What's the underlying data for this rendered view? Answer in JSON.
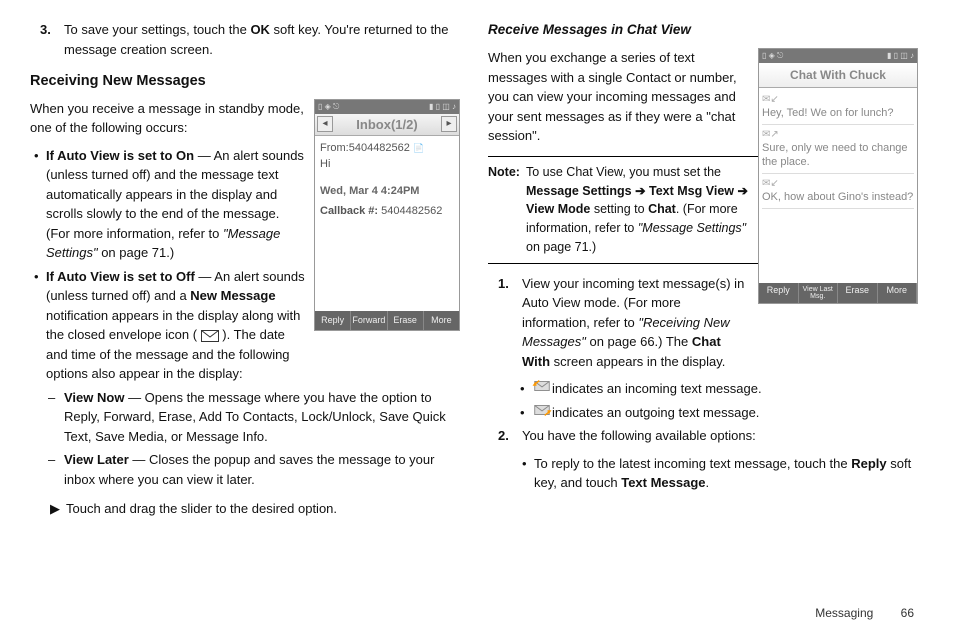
{
  "left": {
    "step3_num": "3.",
    "step3_text_a": "To save your settings, touch the ",
    "step3_ok": "OK",
    "step3_text_b": " soft key. You're returned to the message creation screen.",
    "h2": "Receiving New Messages",
    "intro": "When you receive a message in standby mode, one of the following occurs:",
    "b1_lead": "If Auto View is set to On",
    "b1_rest": " — An alert sounds (unless turned off) and the message text automatically appears in the display and scrolls slowly to the end of the message. (For more information, refer to ",
    "b1_ref": "\"Message Settings\"",
    "b1_pg": "  on page 71.)",
    "b2_lead": "If Auto View is set to Off",
    "b2_rest_a": " — An alert sounds (unless turned off) and a ",
    "b2_newmsg": "New Message",
    "b2_rest_b": " notification appears in the display along with the closed envelope icon ( ",
    "b2_rest_c": " ). The date and time of the message and the following options also appear in the display:",
    "vn_lead": "View Now",
    "vn_rest": " — Opens the message where you have the option to Reply, Forward, Erase, Add To Contacts, Lock/Unlock, Save Quick Text, Save Media, or Message Info.",
    "vl_lead": "View Later",
    "vl_rest": " — Closes the popup and saves the message to your inbox where you can view it later.",
    "slider": "Touch and drag the slider to the desired option."
  },
  "phone1": {
    "title": "Inbox(1/2)",
    "from": "From:5404482562",
    "hi": "Hi",
    "date": "Wed, Mar 4 4:24PM",
    "callback_lbl": "Callback #:",
    "callback_num": " 5404482562",
    "sk": [
      "Reply",
      "Forward",
      "Erase",
      "More"
    ]
  },
  "right": {
    "h3": "Receive Messages in Chat View",
    "intro": "When you exchange a series of text messages with a single Contact or number, you can view your incoming messages and your sent messages as if they were a \"chat session\".",
    "note_label": "Note:",
    "note_a": "To use Chat View, you must set the ",
    "note_b": "Message Settings",
    "note_arr1": " ➔ ",
    "note_c": "Text Msg View",
    "note_arr2": " ➔ ",
    "note_d": "View Mode",
    "note_e": " setting to ",
    "note_f": "Chat",
    "note_g": ". (For more information, refer to ",
    "note_ref": "\"Message Settings\"",
    "note_pg": "  on page 71.)",
    "s1_num": "1.",
    "s1_a": "View your incoming text message(s) in Auto View mode. (For more information, refer to ",
    "s1_ref": "\"Receiving New Messages\"",
    "s1_b": "  on page 66.) The ",
    "s1_c": "Chat With",
    "s1_d": " screen appears in the display.",
    "ico_in": " indicates an incoming text message.",
    "ico_out": " indicates an outgoing text message.",
    "s2_num": "2.",
    "s2_text": "You have the following available options:",
    "s2_b1_a": "To reply to the latest incoming text message, touch the ",
    "s2_b1_b": "Reply",
    "s2_b1_c": " soft key, and touch ",
    "s2_b1_d": "Text Message",
    "s2_b1_e": "."
  },
  "phone2": {
    "title": "Chat With Chuck",
    "m1": "Hey, Ted!  We on for lunch?",
    "m2": "Sure, only we need to change the place.",
    "m3": "OK, how about Gino's instead?",
    "sk": [
      "Reply",
      "View Last Msg.",
      "Erase",
      "More"
    ]
  },
  "footer": {
    "section": "Messaging",
    "page": "66"
  }
}
